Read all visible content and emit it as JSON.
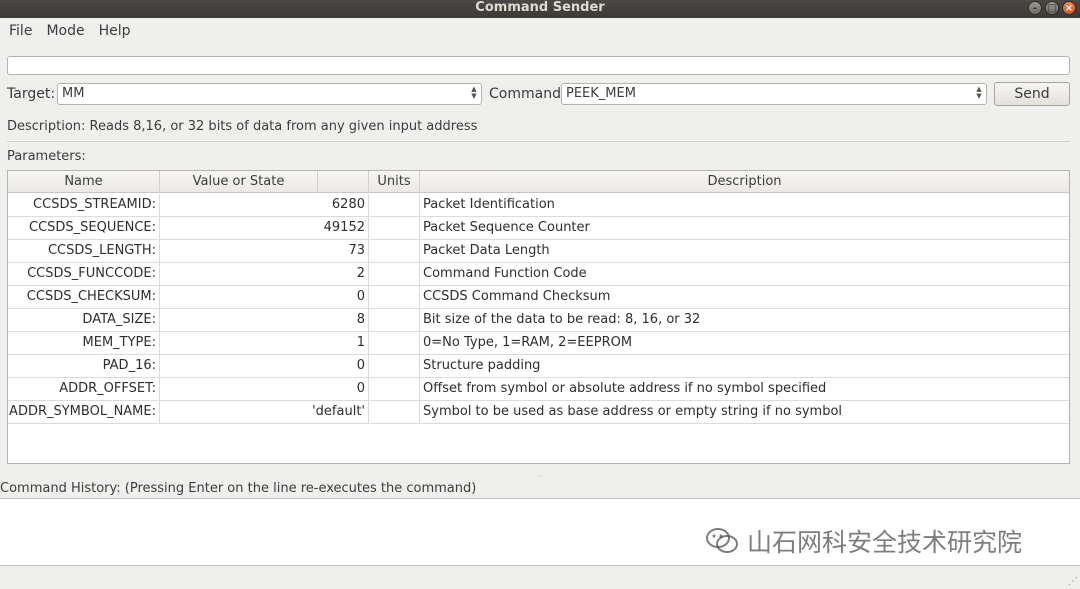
{
  "window": {
    "title": "Command Sender"
  },
  "menu": [
    {
      "label": "File"
    },
    {
      "label": "Mode"
    },
    {
      "label": "Help"
    }
  ],
  "command_line": {
    "value": ""
  },
  "target": {
    "label": "Target:",
    "value": "MM"
  },
  "command": {
    "label": "Command:",
    "value": "PEEK_MEM"
  },
  "send_label": "Send",
  "description": "Description:  Reads 8,16, or 32 bits of data from any given input address",
  "parameters_label": "Parameters:",
  "table": {
    "headers": {
      "name": "Name",
      "value": "Value or State",
      "units": "Units",
      "description": "Description"
    },
    "rows": [
      {
        "name": "CCSDS_STREAMID:",
        "value": "6280",
        "units": "",
        "description": "Packet Identification"
      },
      {
        "name": "CCSDS_SEQUENCE:",
        "value": "49152",
        "units": "",
        "description": "Packet Sequence Counter"
      },
      {
        "name": "CCSDS_LENGTH:",
        "value": "73",
        "units": "",
        "description": "Packet Data Length"
      },
      {
        "name": "CCSDS_FUNCCODE:",
        "value": "2",
        "units": "",
        "description": "Command Function Code"
      },
      {
        "name": "CCSDS_CHECKSUM:",
        "value": "0",
        "units": "",
        "description": "CCSDS Command Checksum"
      },
      {
        "name": "DATA_SIZE:",
        "value": "8",
        "units": "",
        "description": "Bit size of the data to be read: 8, 16, or 32"
      },
      {
        "name": "MEM_TYPE:",
        "value": "1",
        "units": "",
        "description": "0=No Type, 1=RAM, 2=EEPROM"
      },
      {
        "name": "PAD_16:",
        "value": "0",
        "units": "",
        "description": "Structure padding"
      },
      {
        "name": "ADDR_OFFSET:",
        "value": "0",
        "units": "",
        "description": "Offset from symbol or absolute address if no symbol specified"
      },
      {
        "name": "ADDR_SYMBOL_NAME:",
        "value": "'default'",
        "units": "",
        "description": "Symbol to be used as base address or empty string if no symbol"
      }
    ]
  },
  "history_label": "Command History: (Pressing Enter on the line re-executes the command)",
  "watermark": {
    "text": "山石网科安全技术研究院",
    "icon": "wechat-icon"
  }
}
